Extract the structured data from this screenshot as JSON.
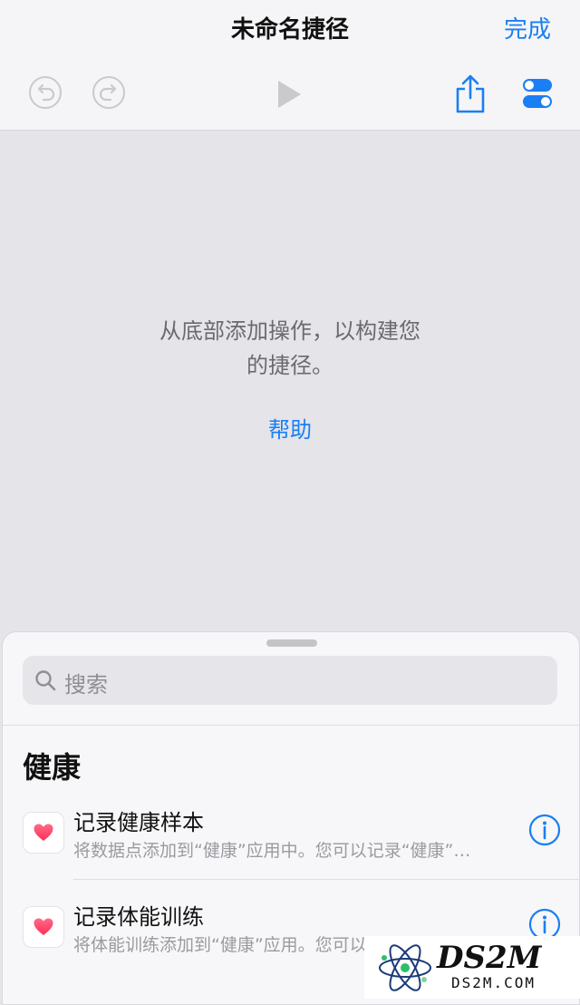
{
  "header": {
    "title": "未命名捷径",
    "done_label": "完成",
    "toolbar_icons": [
      "undo-icon",
      "redo-icon",
      "play-icon",
      "share-icon",
      "settings-toggle-icon"
    ],
    "accent_color": "#1a7ff2"
  },
  "empty_state": {
    "message_line1": "从底部添加操作，以构建您",
    "message_line2": "的捷径。",
    "help_label": "帮助"
  },
  "sheet": {
    "search_placeholder": "搜索",
    "section_title": "健康",
    "items": [
      {
        "title": "记录健康样本",
        "subtitle": "将数据点添加到“健康”应用中。您可以记录“健康”…",
        "icon": "heart-icon"
      },
      {
        "title": "记录体能训练",
        "subtitle": "将体能训练添加到“健康”应用。您可以记录",
        "icon": "heart-icon"
      }
    ]
  },
  "watermark": {
    "main": "DS2M",
    "sub": "DS2M.COM"
  }
}
